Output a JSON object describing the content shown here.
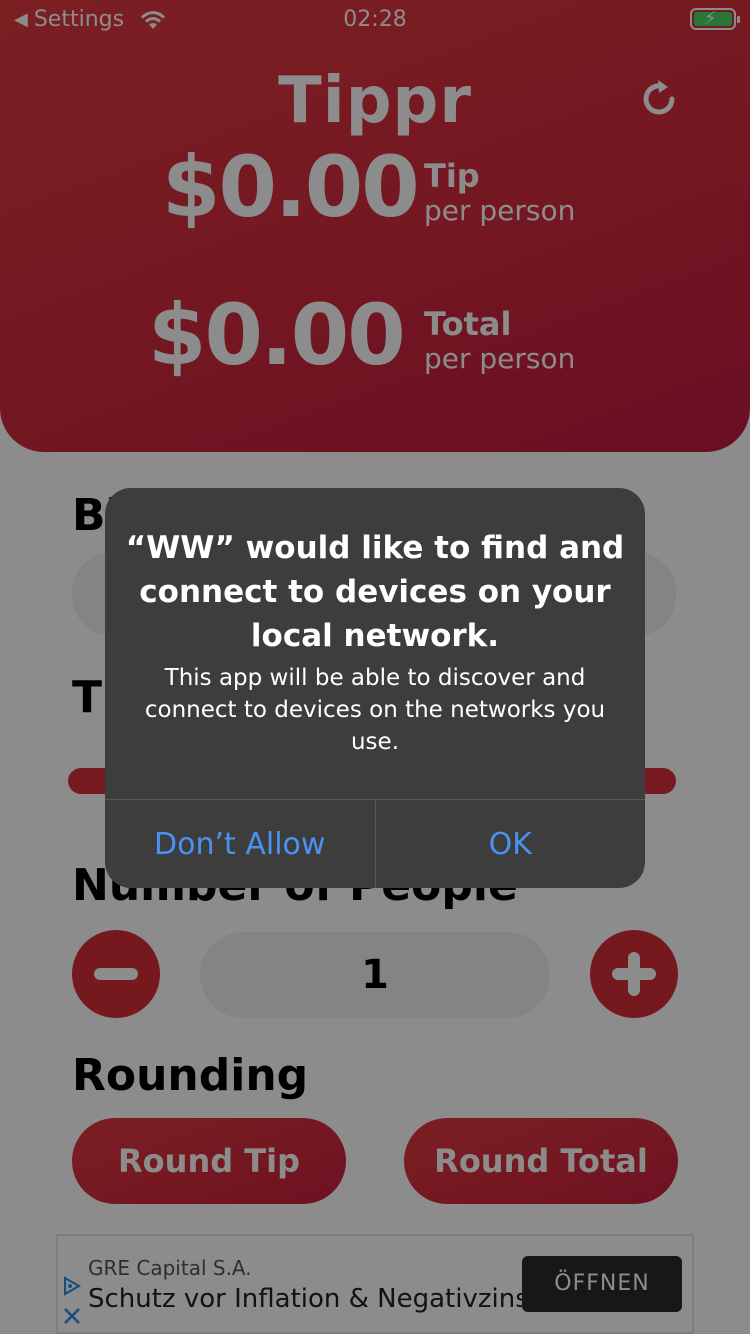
{
  "status_bar": {
    "back_label": "Settings",
    "time": "02:28"
  },
  "header": {
    "app_title": "Tippr",
    "tip_amount": "$0.00",
    "tip_label": "Tip",
    "tip_sublabel": "per person",
    "total_amount": "$0.00",
    "total_label": "Total",
    "total_sublabel": "per person"
  },
  "sections": {
    "bill_title_visible": "Bi",
    "tip_title_visible": "Ti",
    "people_title": "Number of People",
    "people_value": "1",
    "rounding_title": "Rounding",
    "round_tip_label": "Round Tip",
    "round_total_label": "Round Total"
  },
  "ad": {
    "advertiser": "GRE Capital S.A.",
    "headline": "Schutz vor Inflation & Negativzins",
    "cta": "ÖFFNEN"
  },
  "alert": {
    "title": "“WW” would like to find and connect to devices on your local network.",
    "message": "This app will be able to discover and connect to devices on the networks you use.",
    "deny_label": "Don’t Allow",
    "ok_label": "OK"
  },
  "colors": {
    "brand_red": "#d82f3a",
    "battery_green": "#4cd964",
    "alert_button_blue": "#4b92f0"
  }
}
